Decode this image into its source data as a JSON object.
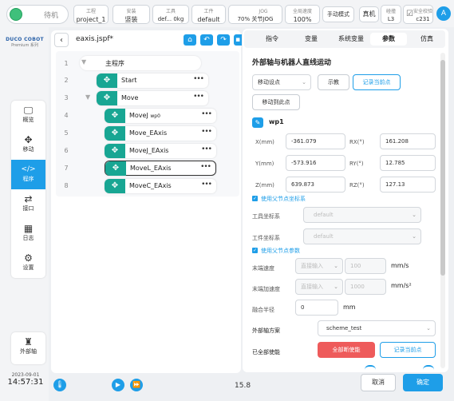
{
  "status": {
    "label": "待机"
  },
  "topbar": {
    "project": {
      "label": "工程",
      "value": "project_1"
    },
    "install": {
      "label": "安装",
      "value": "竖装"
    },
    "tool": {
      "label": "工具",
      "value": "def... 0kg"
    },
    "workpiece": {
      "label": "工件",
      "value": "default"
    },
    "jog": {
      "label": "JOG",
      "value": "70%",
      "sub": "关节JOG"
    },
    "global_speed": {
      "label": "全局速度",
      "value": "100%"
    },
    "manual_mode": "手动模式",
    "real_machine": "真机",
    "collision": {
      "label": "碰撞",
      "value": "L3"
    },
    "safety": {
      "label": "安全校验",
      "value": "c231"
    },
    "avatar": "A"
  },
  "brand": {
    "name": "DUCO COBOT",
    "edition": "Premium 系列"
  },
  "nav": [
    {
      "label": "概览",
      "icon": "monitor-icon"
    },
    {
      "label": "移动",
      "icon": "move-arrows-icon"
    },
    {
      "label": "程序",
      "icon": "code-icon"
    },
    {
      "label": "接口",
      "icon": "swap-icon"
    },
    {
      "label": "日志",
      "icon": "calendar-icon"
    },
    {
      "label": "设置",
      "icon": "gear-icon"
    }
  ],
  "ext_axis_nav": "外部轴",
  "datetime": {
    "date": "2023-09-01",
    "time": "14:57:31"
  },
  "file": {
    "name": "eaxis.jspf*"
  },
  "tree": {
    "root": "主程序",
    "rows": [
      {
        "num": "1",
        "label": "主程序"
      },
      {
        "num": "2",
        "label": "Start"
      },
      {
        "num": "3",
        "label": "Move"
      },
      {
        "num": "4",
        "label": "MoveJ",
        "sub": "wp0"
      },
      {
        "num": "5",
        "label": "Move_EAxis"
      },
      {
        "num": "6",
        "label": "MoveJ_EAxis"
      },
      {
        "num": "7",
        "label": "MoveL_EAxis"
      },
      {
        "num": "8",
        "label": "MoveC_EAxis"
      }
    ]
  },
  "tabs": [
    "指令",
    "变量",
    "系统变量",
    "参数",
    "仿真"
  ],
  "panel": {
    "title": "外部轴与机器人直线运动",
    "move_mode": "移动设点",
    "teach": "示教",
    "record_current": "记录当前点",
    "move_here": "移动到此点",
    "wp_name": "wp1",
    "coords": [
      {
        "label": "X(mm)",
        "value": "-361.079",
        "rlabel": "RX(°)",
        "rvalue": "161.208"
      },
      {
        "label": "Y(mm)",
        "value": "-573.916",
        "rlabel": "RY(°)",
        "rvalue": "12.785"
      },
      {
        "label": "Z(mm)",
        "value": "639.873",
        "rlabel": "RZ(°)",
        "rvalue": "127.13"
      }
    ],
    "use_parent_coord": "使用父节点坐标系",
    "tool_coord": {
      "label": "工具坐标系",
      "value": "default"
    },
    "work_coord": {
      "label": "工件坐标系",
      "value": "default"
    },
    "use_parent_params": "使用父节点参数",
    "speed": {
      "label": "末端速度",
      "mode": "直接输入",
      "value": "100",
      "unit": "mm/s"
    },
    "accel": {
      "label": "末端加速度",
      "mode": "直接输入",
      "value": "1000",
      "unit": "mm/s²"
    },
    "blend": {
      "label": "融合半径",
      "value": "0",
      "unit": "mm"
    },
    "ext_scheme": {
      "label": "外部轴方案",
      "value": "scheme_test"
    },
    "enabled_all": "已全部使能",
    "disable_all": "全部断使能",
    "record_pos": "记录当前点"
  },
  "bottom": {
    "speed": "15.8",
    "cancel": "取消",
    "confirm": "确定"
  }
}
